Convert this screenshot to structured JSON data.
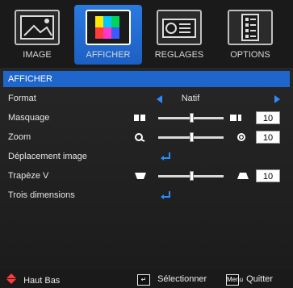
{
  "tabs": [
    {
      "label": "IMAGE",
      "icon": "image-icon"
    },
    {
      "label": "AFFICHER",
      "icon": "display-icon"
    },
    {
      "label": "REGLAGES",
      "icon": "settings-icon"
    },
    {
      "label": "OPTIONS",
      "icon": "options-icon"
    }
  ],
  "active_tab_index": 1,
  "section_title": "AFFICHER",
  "rows": [
    {
      "label": "Format",
      "type": "selector",
      "value": "Natif"
    },
    {
      "label": "Masquage",
      "type": "slider",
      "value": "10",
      "level": 0.5
    },
    {
      "label": "Zoom",
      "type": "slider",
      "value": "10",
      "level": 0.5
    },
    {
      "label": "Déplacement image",
      "type": "enter"
    },
    {
      "label": "Trapèze V",
      "type": "slider",
      "value": "10",
      "level": 0.5
    },
    {
      "label": "Trois dimensions",
      "type": "enter"
    }
  ],
  "footer": {
    "haut_bas": "Haut Bas",
    "selectionner": "Sélectionner",
    "quitter": "Quitter",
    "menu_badge": "Menu"
  },
  "colors": {
    "accent": "#1f66cc",
    "arrow": "#2a8cff",
    "nav_arrows": "#ff3b3b"
  }
}
